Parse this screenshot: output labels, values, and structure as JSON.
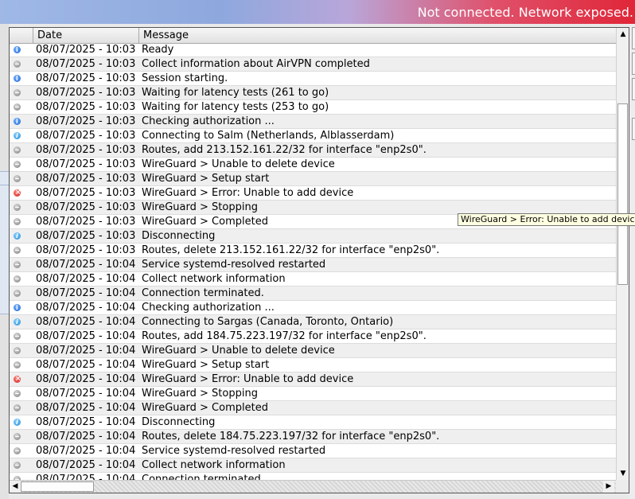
{
  "status_text": "Not connected. Network exposed.",
  "columns": {
    "date": "Date",
    "message": "Message"
  },
  "colors": {
    "error_banner": "#e02638",
    "tooltip_bg": "#ffffe1"
  },
  "rows": [
    {
      "icon": "info",
      "date": "08/07/2025 - 10:03",
      "message": "Ready"
    },
    {
      "icon": "verbose",
      "date": "08/07/2025 - 10:03",
      "message": "Collect information about AirVPN completed"
    },
    {
      "icon": "info",
      "date": "08/07/2025 - 10:03",
      "message": "Session starting."
    },
    {
      "icon": "verbose",
      "date": "08/07/2025 - 10:03",
      "message": "Waiting for latency tests (261 to go)"
    },
    {
      "icon": "verbose",
      "date": "08/07/2025 - 10:03",
      "message": "Waiting for latency tests (253 to go)"
    },
    {
      "icon": "info",
      "date": "08/07/2025 - 10:03",
      "message": "Checking authorization ..."
    },
    {
      "icon": "infoq",
      "date": "08/07/2025 - 10:03",
      "message": "Connecting to Salm (Netherlands, Alblasserdam)"
    },
    {
      "icon": "verbose",
      "date": "08/07/2025 - 10:03",
      "message": "Routes, add 213.152.161.22/32 for interface \"enp2s0\"."
    },
    {
      "icon": "verbose",
      "date": "08/07/2025 - 10:03",
      "message": "WireGuard > Unable to delete device"
    },
    {
      "icon": "verbose",
      "date": "08/07/2025 - 10:03",
      "message": "WireGuard > Setup start"
    },
    {
      "icon": "error",
      "date": "08/07/2025 - 10:03",
      "message": "WireGuard > Error: Unable to add device"
    },
    {
      "icon": "verbose",
      "date": "08/07/2025 - 10:03",
      "message": "WireGuard > Stopping"
    },
    {
      "icon": "verbose",
      "date": "08/07/2025 - 10:03",
      "message": "WireGuard > Completed"
    },
    {
      "icon": "infoq",
      "date": "08/07/2025 - 10:03",
      "message": "Disconnecting"
    },
    {
      "icon": "verbose",
      "date": "08/07/2025 - 10:03",
      "message": "Routes, delete 213.152.161.22/32 for interface \"enp2s0\"."
    },
    {
      "icon": "verbose",
      "date": "08/07/2025 - 10:04",
      "message": "Service systemd-resolved restarted"
    },
    {
      "icon": "verbose",
      "date": "08/07/2025 - 10:04",
      "message": "Collect network information"
    },
    {
      "icon": "verbose",
      "date": "08/07/2025 - 10:04",
      "message": "Connection terminated."
    },
    {
      "icon": "info",
      "date": "08/07/2025 - 10:04",
      "message": "Checking authorization ..."
    },
    {
      "icon": "infoq",
      "date": "08/07/2025 - 10:04",
      "message": "Connecting to Sargas (Canada, Toronto, Ontario)"
    },
    {
      "icon": "verbose",
      "date": "08/07/2025 - 10:04",
      "message": "Routes, add 184.75.223.197/32 for interface \"enp2s0\"."
    },
    {
      "icon": "verbose",
      "date": "08/07/2025 - 10:04",
      "message": "WireGuard > Unable to delete device"
    },
    {
      "icon": "verbose",
      "date": "08/07/2025 - 10:04",
      "message": "WireGuard > Setup start"
    },
    {
      "icon": "error",
      "date": "08/07/2025 - 10:04",
      "message": "WireGuard > Error: Unable to add device"
    },
    {
      "icon": "verbose",
      "date": "08/07/2025 - 10:04",
      "message": "WireGuard > Stopping"
    },
    {
      "icon": "verbose",
      "date": "08/07/2025 - 10:04",
      "message": "WireGuard > Completed"
    },
    {
      "icon": "infoq",
      "date": "08/07/2025 - 10:04",
      "message": "Disconnecting"
    },
    {
      "icon": "verbose",
      "date": "08/07/2025 - 10:04",
      "message": "Routes, delete 184.75.223.197/32 for interface \"enp2s0\"."
    },
    {
      "icon": "verbose",
      "date": "08/07/2025 - 10:04",
      "message": "Service systemd-resolved restarted"
    },
    {
      "icon": "verbose",
      "date": "08/07/2025 - 10:04",
      "message": "Collect network information"
    },
    {
      "icon": "verbose",
      "date": "08/07/2025 - 10:04",
      "message": "Connection terminated."
    }
  ],
  "tooltip": "WireGuard > Error: Unable to add device"
}
